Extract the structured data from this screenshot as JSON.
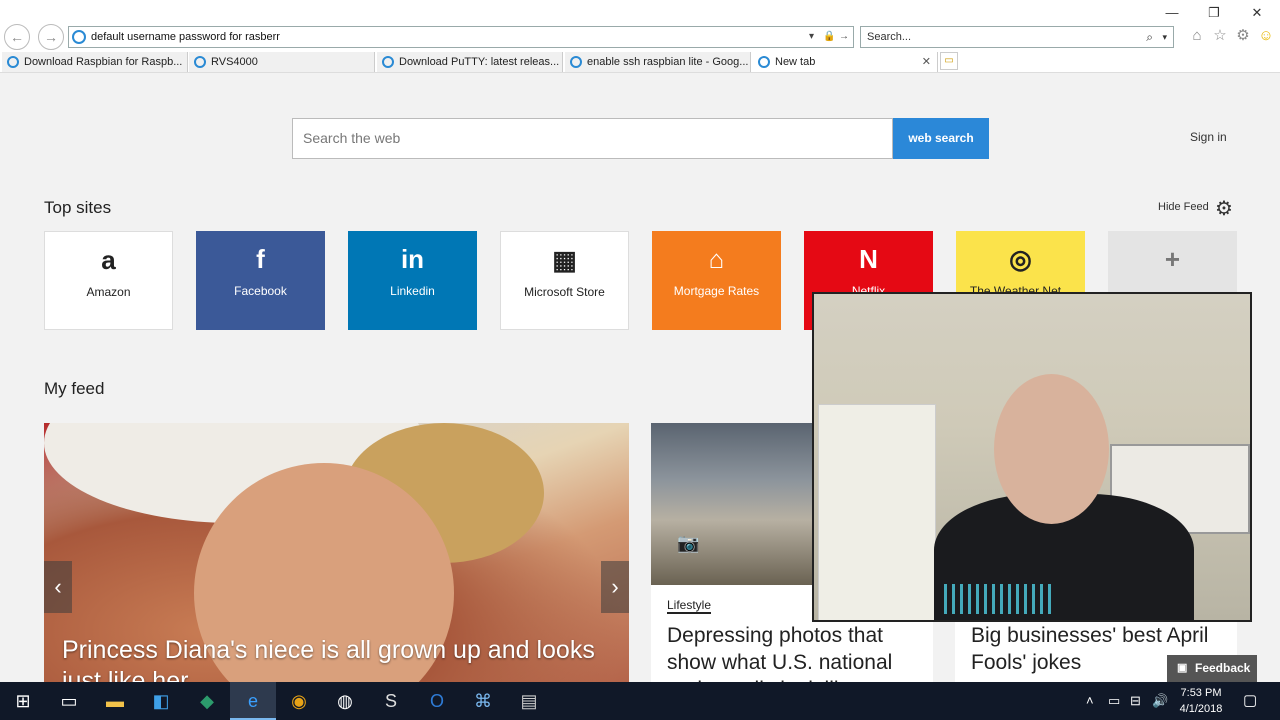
{
  "browser": {
    "address": "default username password for rasberr",
    "search_placeholder": "Search...",
    "back_glyph": "←",
    "forward_glyph": "→",
    "window_controls": [
      "—",
      "❐",
      "✕"
    ]
  },
  "tabs": [
    {
      "label": "Download Raspbian for Raspb..."
    },
    {
      "label": "RVS4000"
    },
    {
      "label": "Download PuTTY: latest releas..."
    },
    {
      "label": "enable ssh raspbian lite - Goog..."
    },
    {
      "label": "New tab"
    }
  ],
  "page": {
    "search_placeholder": "Search the web",
    "search_button": "web search",
    "sign_in": "Sign in",
    "top_sites_title": "Top sites",
    "hide_feed": "Hide Feed",
    "my_feed_title": "My feed"
  },
  "top_sites": [
    {
      "label": "Amazon",
      "glyph": "a",
      "bg": "#ffffff",
      "fg": "#222222"
    },
    {
      "label": "Facebook",
      "glyph": "f",
      "bg": "#3b5998",
      "fg": "#ffffff"
    },
    {
      "label": "Linkedin",
      "glyph": "in",
      "bg": "#0077b5",
      "fg": "#ffffff"
    },
    {
      "label": "Microsoft Store",
      "glyph": "▦",
      "bg": "#ffffff",
      "fg": "#222222"
    },
    {
      "label": "Mortgage Rates",
      "glyph": "⌂",
      "bg": "#f47c1e",
      "fg": "#ffffff"
    },
    {
      "label": "Netflix",
      "glyph": "N",
      "bg": "#e50914",
      "fg": "#ffffff"
    },
    {
      "label": "The Weather Net...",
      "glyph": "◎",
      "bg": "#fbe34b",
      "fg": "#222222"
    },
    {
      "label": "",
      "glyph": "+",
      "bg": "#e4e4e4",
      "fg": "#777777"
    }
  ],
  "feed": {
    "hero_headline": "Princess Diana's niece is all grown up and looks just like her",
    "card2_category": "Lifestyle",
    "card2_headline": "Depressing photos that show what U.S. national parks really look like",
    "card3_headline": "Big businesses' best April Fools' jokes",
    "feedback_label": "Feedback"
  },
  "taskbar": {
    "time": "7:53 PM",
    "date": "4/1/2018"
  },
  "colors": {
    "accent": "#2b88d8",
    "taskbar": "#101828"
  }
}
